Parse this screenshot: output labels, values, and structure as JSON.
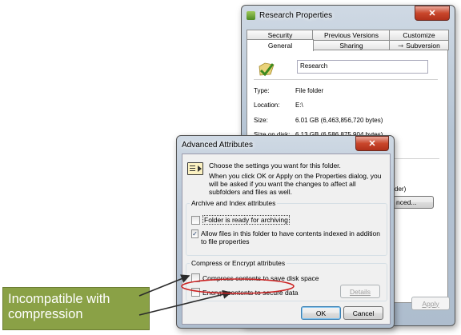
{
  "properties_window": {
    "title": "Research Properties",
    "tabs_top": [
      "Security",
      "Previous Versions",
      "Customize"
    ],
    "tabs_bottom": [
      "General",
      "Sharing",
      "Subversion"
    ],
    "folder_name": "Research",
    "rows": [
      {
        "label": "Type:",
        "value": "File folder"
      },
      {
        "label": "Location:",
        "value": "E:\\"
      },
      {
        "label": "Size:",
        "value": "6.01 GB (6,463,856,720 bytes)"
      },
      {
        "label": "Size on disk:",
        "value": "6.13 GB (6,586,875,904 bytes)"
      }
    ],
    "partial_text": "der)",
    "advanced_button_partial": "nced...",
    "apply_label": "Apply"
  },
  "advanced_dialog": {
    "title": "Advanced Attributes",
    "intro_line1": "Choose the settings you want for this folder.",
    "intro_line2": "When you click OK or Apply on the Properties dialog, you will be asked if you want the changes to affect all subfolders and files as well.",
    "archive_group_label": "Archive and Index attributes",
    "archive_option": {
      "label": "Folder is ready for archiving",
      "checked": false
    },
    "index_option": {
      "label": "Allow files in this folder to have contents indexed in addition to file properties",
      "checked": true
    },
    "compress_group_label": "Compress or Encrypt attributes",
    "compress_option": {
      "label": "Compress contents to save disk space",
      "checked": false
    },
    "encrypt_option": {
      "label": "Encrypt contents to secure data",
      "checked": false
    },
    "details_label": "Details",
    "ok_label": "OK",
    "cancel_label": "Cancel"
  },
  "callout": {
    "text_line1": "Incompatible with",
    "text_line2": "compression",
    "color": "#8aa146",
    "highlight_color": "#cc2222"
  }
}
